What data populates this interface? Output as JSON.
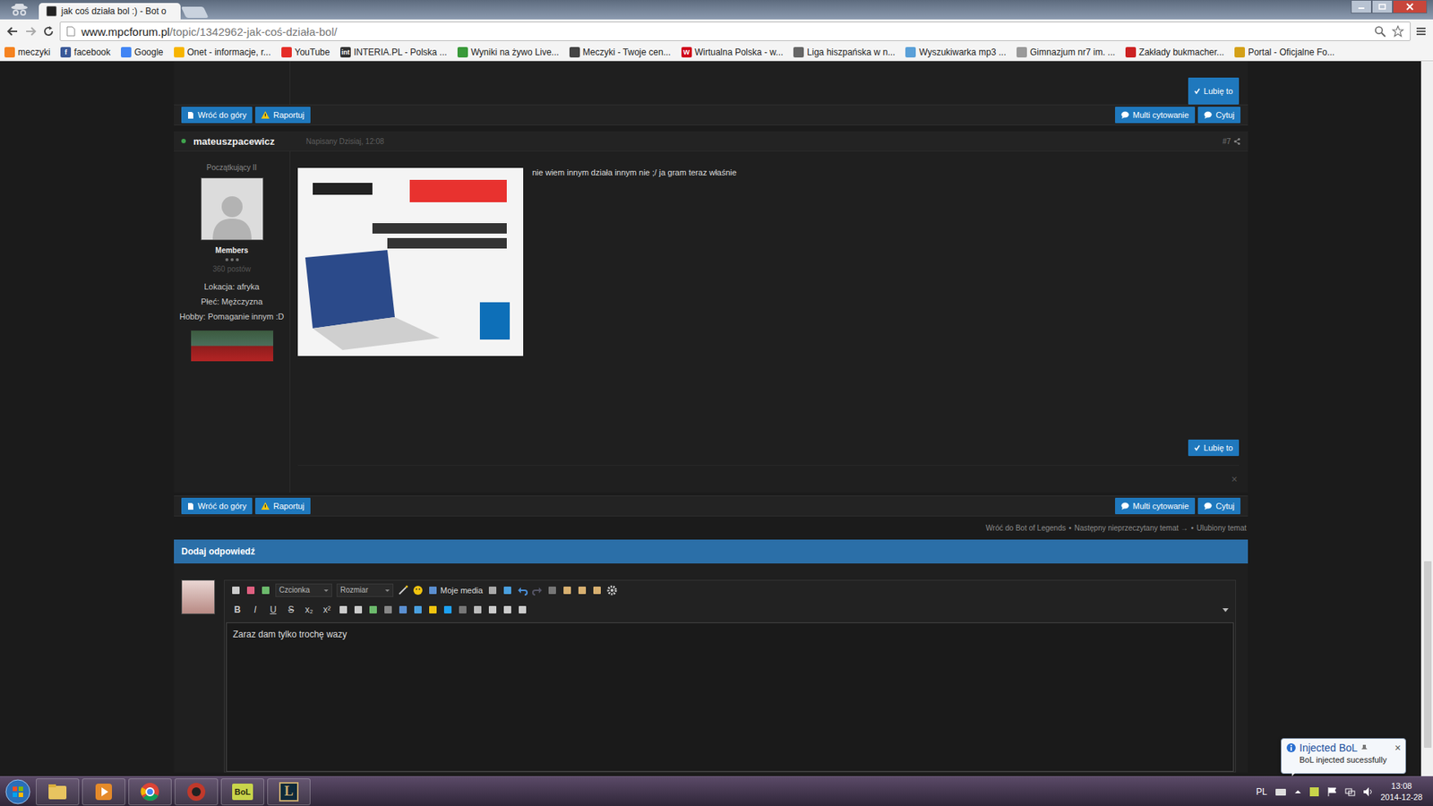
{
  "browser": {
    "tab": {
      "label": "jak coś działa bol :) - Bot o",
      "selected": true
    },
    "address": {
      "host": "www.mpcforum.pl",
      "path": "/topic/1342962-jak-coś-działa-bol/"
    },
    "bookmarks": [
      {
        "label": "meczyki",
        "color": "#f58220",
        "glyph": ""
      },
      {
        "label": "facebook",
        "color": "#3b5998",
        "glyph": "f"
      },
      {
        "label": "Google",
        "color": "#4285f4",
        "glyph": ""
      },
      {
        "label": "Onet - informacje, r...",
        "color": "#f7b500",
        "glyph": ""
      },
      {
        "label": "YouTube",
        "color": "#e52d27",
        "glyph": ""
      },
      {
        "label": "INTERIA.PL - Polska ...",
        "color": "#333333",
        "glyph": "int"
      },
      {
        "label": "Wyniki na żywo Live...",
        "color": "#3a9a3a",
        "glyph": ""
      },
      {
        "label": "Meczyki - Twoje cen...",
        "color": "#444444",
        "glyph": ""
      },
      {
        "label": "Wirtualna Polska - w...",
        "color": "#d0021b",
        "glyph": "W"
      },
      {
        "label": "Liga hiszpańska w n...",
        "color": "#666666",
        "glyph": ""
      },
      {
        "label": "Wyszukiwarka mp3 ...",
        "color": "#5aa0d8",
        "glyph": ""
      },
      {
        "label": "Gimnazjum nr7 im. ...",
        "color": "#9a9a9a",
        "glyph": ""
      },
      {
        "label": "Zakłady bukmacher...",
        "color": "#cc2222",
        "glyph": ""
      },
      {
        "label": "Portal - Oficjalne Fo...",
        "color": "#d4a017",
        "glyph": ""
      }
    ]
  },
  "previous_post": {
    "like": "Lubię to"
  },
  "action_bars": [
    {
      "back_to_top": "Wróć do góry",
      "report": "Raportuj",
      "multi_quote": "Multi cytowanie",
      "quote": "Cytuj"
    },
    {
      "back_to_top": "Wróć do góry",
      "report": "Raportuj",
      "multi_quote": "Multi cytowanie",
      "quote": "Cytuj"
    }
  ],
  "post": {
    "author": "mateuszpacewicz",
    "online": true,
    "date": "Napisany Dzisiaj, 12:08",
    "number": "#7",
    "rank": "Początkujący II",
    "group": "Members",
    "posts": "360 postów",
    "fields": [
      "Lokacja: afryka",
      "Płeć: Mężczyzna",
      "Hobby: Pomaganie innym :D"
    ],
    "body": "nie wiem innym działa innym nie ;/ ja gram teraz właśnie",
    "like": "Lubię to",
    "close": "×"
  },
  "nav_links": {
    "items": [
      "Wróć do Bot of Legends",
      "Następny nieprzeczytany temat →",
      "Ulubiony temat"
    ],
    "separator": "•"
  },
  "reply": {
    "title": "Dodaj odpowiedź",
    "font_select": "Czcionka",
    "size_select": "Rozmiar",
    "my_media": "Moje media",
    "format_buttons": [
      "B",
      "I",
      "U",
      "S",
      "x₂",
      "x²"
    ],
    "text": "Zaraz dam tylko trochę wazy"
  },
  "taskbar": {
    "apps": [
      {
        "kind": "explorer",
        "label": ""
      },
      {
        "kind": "media",
        "label": ""
      },
      {
        "kind": "chrome",
        "label": ""
      },
      {
        "kind": "record",
        "label": ""
      },
      {
        "kind": "bol",
        "label": "BoL"
      },
      {
        "kind": "lol",
        "label": "L"
      }
    ],
    "language": "PL",
    "time": "13:08",
    "date": "2014-12-28"
  },
  "notification": {
    "title": "Injected BoL",
    "message": "BoL injected sucessfully",
    "close": "×"
  }
}
